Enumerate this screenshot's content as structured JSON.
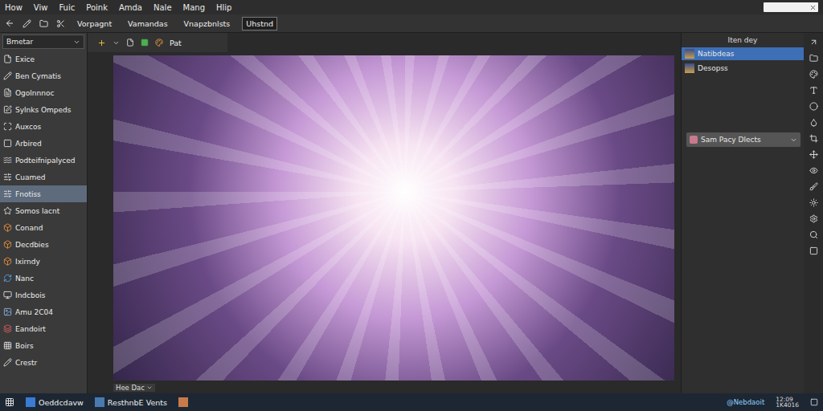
{
  "menu": [
    "How",
    "Viw",
    "Fuic",
    "Poink",
    "Amda",
    "Nale",
    "Mang",
    "Hlip"
  ],
  "toolbar": {
    "items": [
      {
        "label": "Vorpagnt",
        "selected": false
      },
      {
        "label": "Vamandas",
        "selected": false
      },
      {
        "label": "Vnapzbnlsts",
        "selected": false
      },
      {
        "label": "Uhstnd",
        "selected": true
      }
    ]
  },
  "left_panel": {
    "header": "Bmetar",
    "items": [
      {
        "label": "Exice",
        "selected": false
      },
      {
        "label": "Ben Cymatis",
        "selected": false
      },
      {
        "label": "Ogolnnnoc",
        "selected": false
      },
      {
        "label": "Sylnks Ompeds",
        "selected": false
      },
      {
        "label": "Auxcos",
        "selected": false
      },
      {
        "label": "Arbired",
        "selected": false
      },
      {
        "label": "Podteifnipalyced",
        "selected": false
      },
      {
        "label": "Cuamed",
        "selected": false
      },
      {
        "label": "Fnotiss",
        "selected": true
      },
      {
        "label": "Somos lacnt",
        "selected": false
      },
      {
        "label": "Conand",
        "selected": false
      },
      {
        "label": "Decdbies",
        "selected": false
      },
      {
        "label": "Ixirndy",
        "selected": false
      },
      {
        "label": "Nanc",
        "selected": false
      },
      {
        "label": "Indcbois",
        "selected": false
      },
      {
        "label": "Amu 2C04",
        "selected": false
      },
      {
        "label": "Eandoirt",
        "selected": false
      },
      {
        "label": "Boirs",
        "selected": false
      },
      {
        "label": "Crestr",
        "selected": false
      }
    ]
  },
  "canvas_toolbar": {
    "label": "Pat"
  },
  "canvas_footer": {
    "label": "Hee Dac"
  },
  "right_panel": {
    "header": "Iten dey",
    "items": [
      {
        "label": "Natibdeas",
        "selected": true
      },
      {
        "label": "Desopss",
        "selected": false
      }
    ],
    "dropdown": "Sam Pacy Dlects"
  },
  "taskbar": {
    "items": [
      "Oeddcdavw",
      "ResthnbE Vents"
    ],
    "tray": "@Nebdaoit",
    "time": "12:09",
    "date": "1K4016"
  }
}
